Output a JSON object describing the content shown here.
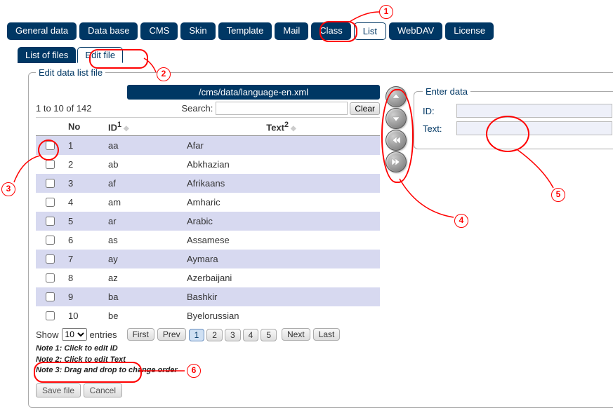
{
  "main_tabs": {
    "items": [
      "General data",
      "Data base",
      "CMS",
      "Skin",
      "Template",
      "Mail",
      "Class",
      "List",
      "WebDAV",
      "License"
    ],
    "active_index": 7
  },
  "sub_tabs": {
    "items": [
      "List of files",
      "Edit file"
    ],
    "active_index": 1
  },
  "panel": {
    "legend": "Edit data list file",
    "file_path": "/cms/data/language-en.xml",
    "range_text": "1 to 10 of 142",
    "search_label": "Search:",
    "search_value": "",
    "clear_label": "Clear"
  },
  "columns": {
    "no": "No",
    "id": "ID",
    "id_sup": "1",
    "text": "Text",
    "text_sup": "2"
  },
  "rows": [
    {
      "no": "1",
      "id": "aa",
      "text": "Afar"
    },
    {
      "no": "2",
      "id": "ab",
      "text": "Abkhazian"
    },
    {
      "no": "3",
      "id": "af",
      "text": "Afrikaans"
    },
    {
      "no": "4",
      "id": "am",
      "text": "Amharic"
    },
    {
      "no": "5",
      "id": "ar",
      "text": "Arabic"
    },
    {
      "no": "6",
      "id": "as",
      "text": "Assamese"
    },
    {
      "no": "7",
      "id": "ay",
      "text": "Aymara"
    },
    {
      "no": "8",
      "id": "az",
      "text": "Azerbaijani"
    },
    {
      "no": "9",
      "id": "ba",
      "text": "Bashkir"
    },
    {
      "no": "10",
      "id": "be",
      "text": "Byelorussian"
    }
  ],
  "pager": {
    "show_label": "Show",
    "page_size": "10",
    "entries_label": "entries",
    "first": "First",
    "prev": "Prev",
    "pages": [
      "1",
      "2",
      "3",
      "4",
      "5"
    ],
    "active_page_index": 0,
    "next": "Next",
    "last": "Last"
  },
  "notes": {
    "n1": "Note 1: Click to edit ID",
    "n2": "Note 2: Click to edit Text",
    "n3": "Note 3: Drag and drop to change order"
  },
  "actions": {
    "save": "Save file",
    "cancel": "Cancel"
  },
  "form": {
    "legend": "Enter data",
    "id_label": "ID:",
    "id_value": "",
    "text_label": "Text:",
    "text_value": ""
  },
  "annotations": {
    "n1": "1",
    "n2": "2",
    "n3": "3",
    "n4": "4",
    "n5": "5",
    "n6": "6"
  }
}
